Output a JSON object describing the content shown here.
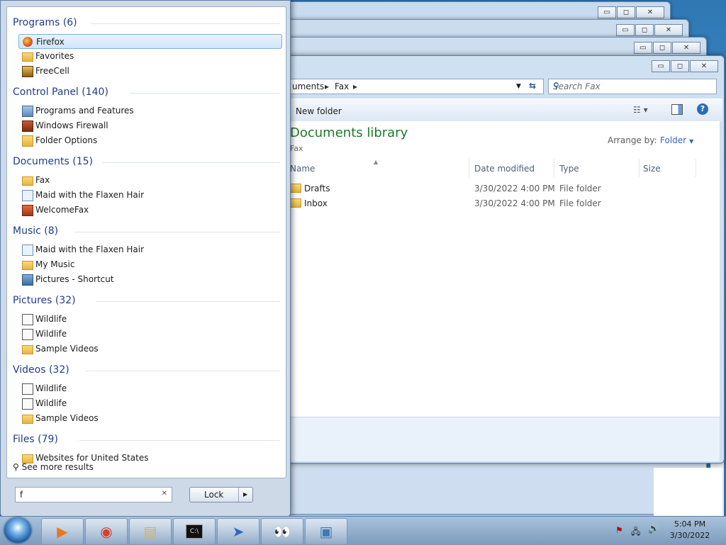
{
  "background_windows": [
    {
      "name": "window-1"
    },
    {
      "name": "window-2"
    },
    {
      "name": "window-3"
    }
  ],
  "caption_buttons": {
    "minimize": "▭",
    "maximize": "◻",
    "close": "✕"
  },
  "explorer": {
    "breadcrumb": [
      "uments",
      "Fax"
    ],
    "search_placeholder": "Search Fax",
    "toolbar": {
      "new_folder": "New folder"
    },
    "library_title": "Documents library",
    "library_sub": "Fax",
    "arrange_label": "Arrange by:",
    "arrange_value": "Folder",
    "columns": [
      "Name",
      "Date modified",
      "Type",
      "Size"
    ],
    "rows": [
      {
        "name": "Drafts",
        "date": "3/30/2022 4:00 PM",
        "type": "File folder",
        "size": ""
      },
      {
        "name": "Inbox",
        "date": "3/30/2022 4:00 PM",
        "type": "File folder",
        "size": ""
      }
    ]
  },
  "startmenu": {
    "groups": [
      {
        "title": "Programs (6)",
        "items": [
          {
            "label": "Firefox",
            "icon": "firefox-icon",
            "selected": true
          },
          {
            "label": "Favorites",
            "icon": "folder-icon"
          },
          {
            "label": "FreeCell",
            "icon": "freecell-icon"
          }
        ]
      },
      {
        "title": "Control Panel (140)",
        "items": [
          {
            "label": "Programs and Features",
            "icon": "control-panel-icon"
          },
          {
            "label": "Windows Firewall",
            "icon": "firewall-icon"
          },
          {
            "label": "Folder Options",
            "icon": "folder-options-icon"
          }
        ]
      },
      {
        "title": "Documents (15)",
        "items": [
          {
            "label": "Fax",
            "icon": "folder-icon"
          },
          {
            "label": "Maid with the Flaxen Hair",
            "icon": "music-file-icon"
          },
          {
            "label": "WelcomeFax",
            "icon": "fax-icon"
          }
        ]
      },
      {
        "title": "Music (8)",
        "items": [
          {
            "label": "Maid with the Flaxen Hair",
            "icon": "music-file-icon"
          },
          {
            "label": "My Music",
            "icon": "folder-icon"
          },
          {
            "label": "Pictures - Shortcut",
            "icon": "picture-icon"
          }
        ]
      },
      {
        "title": "Pictures (32)",
        "items": [
          {
            "label": "Wildlife",
            "icon": "video-file-icon"
          },
          {
            "label": "Wildlife",
            "icon": "video-file-icon"
          },
          {
            "label": "Sample Videos",
            "icon": "folder-icon"
          }
        ]
      },
      {
        "title": "Videos (32)",
        "items": [
          {
            "label": "Wildlife",
            "icon": "video-file-icon"
          },
          {
            "label": "Wildlife",
            "icon": "video-file-icon"
          },
          {
            "label": "Sample Videos",
            "icon": "folder-icon"
          }
        ]
      },
      {
        "title": "Files (79)",
        "items": [
          {
            "label": "Websites for United States",
            "icon": "folder-icon"
          }
        ]
      }
    ],
    "see_more": "See more results",
    "search_value": "f",
    "clear_glyph": "✕",
    "lock_label": "Lock",
    "lock_arrow": "▶"
  },
  "taskbar": {
    "apps": [
      {
        "name": "media-player-icon"
      },
      {
        "name": "chrome-icon"
      },
      {
        "name": "explorer-icon"
      },
      {
        "name": "cmd-icon"
      },
      {
        "name": "paper-plane-icon"
      },
      {
        "name": "eyes-icon"
      },
      {
        "name": "photo-viewer-icon"
      }
    ],
    "time": "5:04 PM",
    "date": "3/30/2022"
  }
}
